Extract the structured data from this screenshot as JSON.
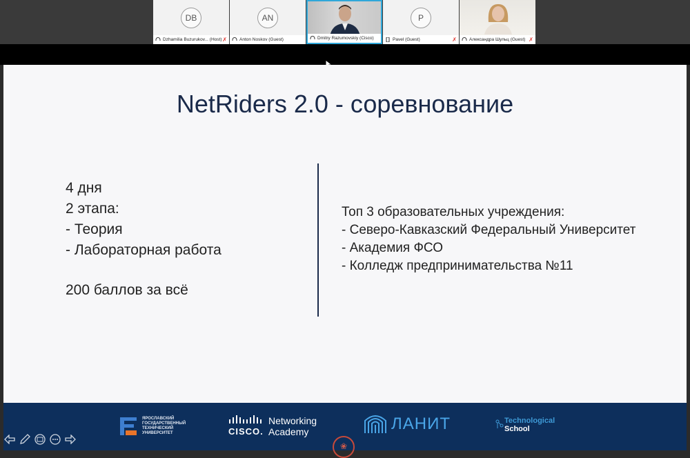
{
  "participants": [
    {
      "initials": "DB",
      "name": "Dzhamilia Buzurukov... (Host)",
      "video": false,
      "muted": true
    },
    {
      "initials": "AN",
      "name": "Anton Noskov (Guest)",
      "video": false,
      "muted": false
    },
    {
      "initials": "",
      "name": "Dmitry Razumovskiy (Cisco)",
      "video": true,
      "muted": false,
      "active": true
    },
    {
      "initials": "P",
      "name": "Pavel (Guest)",
      "video": false,
      "muted": true
    },
    {
      "initials": "",
      "name": "Александра Шульц (Guest)",
      "video": true,
      "muted": true
    }
  ],
  "slide": {
    "title": "NetRiders 2.0 - соревнование",
    "left": {
      "line1": "4 дня",
      "line2": "2 этапа:",
      "line3": "- Теория",
      "line4": "- Лабораторная работа",
      "line5": "200 баллов за всё"
    },
    "right": {
      "heading": "Топ 3 образовательных учреждения:",
      "items": [
        "- Северо-Кавказский Федеральный Университет",
        "- Академия ФСО",
        "- Колледж предпринимательства №11"
      ]
    },
    "footer": {
      "ystu_line1": "ЯРОСЛАВСКИЙ",
      "ystu_line2": "ГОСУДАРСТВЕННЫЙ",
      "ystu_line3": "ТЕХНИЧЕСКИЙ",
      "ystu_line4": "УНИВЕРСИТЕТ",
      "cisco_word": "CISCO.",
      "cisco_line1": "Networking",
      "cisco_line2": "Academy",
      "lanit": "ЛАНИТ",
      "tech_line1": "Technological",
      "tech_line2": "School"
    }
  },
  "colors": {
    "footer_bg": "#0d2f5c",
    "title": "#1a2a4a",
    "active_border": "#2fa7d9",
    "mute_red": "#e0332d",
    "lanit_blue": "#4aa6e8"
  },
  "icons": [
    "mic-muted-icon",
    "headset-icon",
    "cursor-arrow-icon",
    "pen-icon",
    "prev-arrow-icon",
    "next-arrow-icon",
    "grid-icon",
    "more-icon",
    "record-icon"
  ]
}
